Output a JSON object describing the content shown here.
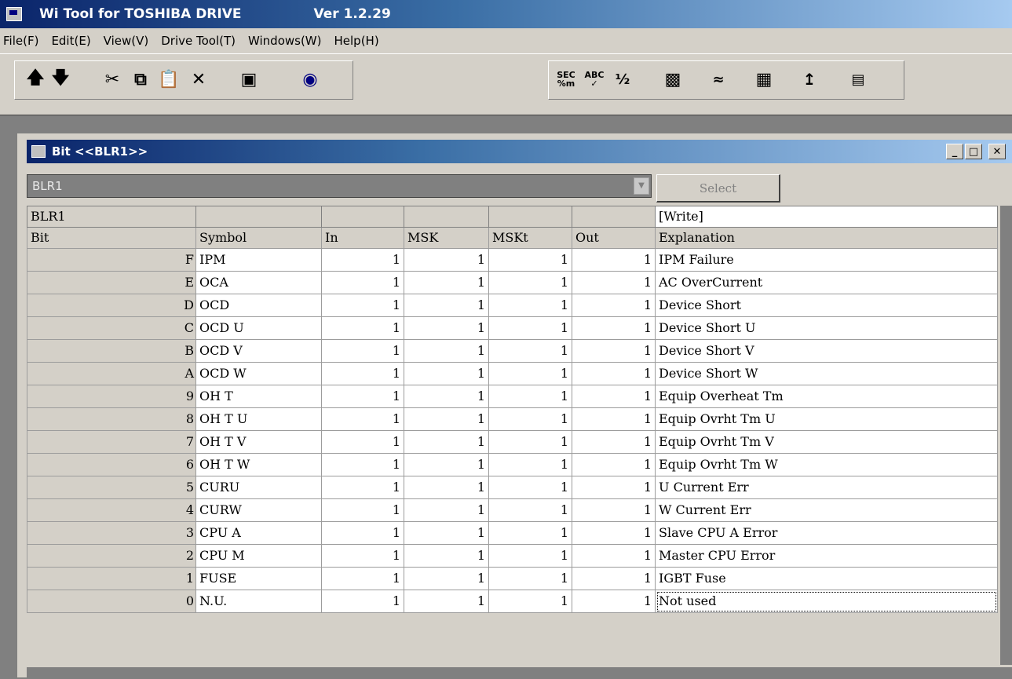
{
  "app": {
    "title": "Wi Tool  for TOSHIBA DRIVE",
    "version": "Ver 1.2.29"
  },
  "menu": [
    "File(F)",
    "Edit(E)",
    "View(V)",
    "Drive Tool(T)",
    "Windows(W)",
    "Help(H)"
  ],
  "toolbar": {
    "left_icons": [
      "arrow-up-icon",
      "arrow-down-icon",
      "cut-icon",
      "copy-icon",
      "paste-icon",
      "delete-icon",
      "properties-icon",
      "monitor-eye-icon"
    ],
    "right_icons": [
      "sec-icon",
      "abc-check-icon",
      "fraction-icon",
      "save-disk-icon",
      "waveform-icon",
      "folder-icon",
      "chart-icon",
      "percent-icon"
    ]
  },
  "child": {
    "title": "Bit <<BLR1>>",
    "selector_value": "BLR1",
    "select_label": "Select"
  },
  "grid": {
    "corner_label": "BLR1",
    "write_label": "[Write]",
    "columns": [
      "Bit",
      "Symbol",
      "In",
      "MSK",
      "MSKt",
      "Out",
      "Explanation"
    ],
    "rows": [
      {
        "bit": "F",
        "symbol": "IPM",
        "in": "1",
        "msk": "1",
        "mskt": "1",
        "out": "1",
        "explanation": "IPM Failure"
      },
      {
        "bit": "E",
        "symbol": "OCA",
        "in": "1",
        "msk": "1",
        "mskt": "1",
        "out": "1",
        "explanation": "AC OverCurrent"
      },
      {
        "bit": "D",
        "symbol": "OCD",
        "in": "1",
        "msk": "1",
        "mskt": "1",
        "out": "1",
        "explanation": "Device Short"
      },
      {
        "bit": "C",
        "symbol": "OCD  U",
        "in": "1",
        "msk": "1",
        "mskt": "1",
        "out": "1",
        "explanation": "Device Short U"
      },
      {
        "bit": "B",
        "symbol": "OCD  V",
        "in": "1",
        "msk": "1",
        "mskt": "1",
        "out": "1",
        "explanation": "Device Short V"
      },
      {
        "bit": "A",
        "symbol": "OCD  W",
        "in": "1",
        "msk": "1",
        "mskt": "1",
        "out": "1",
        "explanation": "Device Short W"
      },
      {
        "bit": "9",
        "symbol": "OH  T",
        "in": "1",
        "msk": "1",
        "mskt": "1",
        "out": "1",
        "explanation": "Equip Overheat Tm"
      },
      {
        "bit": "8",
        "symbol": "OH  T  U",
        "in": "1",
        "msk": "1",
        "mskt": "1",
        "out": "1",
        "explanation": "Equip Ovrht Tm U"
      },
      {
        "bit": "7",
        "symbol": "OH  T  V",
        "in": "1",
        "msk": "1",
        "mskt": "1",
        "out": "1",
        "explanation": "Equip Ovrht Tm V"
      },
      {
        "bit": "6",
        "symbol": "OH  T  W",
        "in": "1",
        "msk": "1",
        "mskt": "1",
        "out": "1",
        "explanation": "Equip Ovrht Tm W"
      },
      {
        "bit": "5",
        "symbol": "CURU",
        "in": "1",
        "msk": "1",
        "mskt": "1",
        "out": "1",
        "explanation": "U Current Err"
      },
      {
        "bit": "4",
        "symbol": "CURW",
        "in": "1",
        "msk": "1",
        "mskt": "1",
        "out": "1",
        "explanation": "W Current Err"
      },
      {
        "bit": "3",
        "symbol": "CPU  A",
        "in": "1",
        "msk": "1",
        "mskt": "1",
        "out": "1",
        "explanation": "Slave CPU A Error"
      },
      {
        "bit": "2",
        "symbol": "CPU  M",
        "in": "1",
        "msk": "1",
        "mskt": "1",
        "out": "1",
        "explanation": "Master CPU Error"
      },
      {
        "bit": "1",
        "symbol": "FUSE",
        "in": "1",
        "msk": "1",
        "mskt": "1",
        "out": "1",
        "explanation": "IGBT Fuse"
      },
      {
        "bit": "0",
        "symbol": "N.U.",
        "in": "1",
        "msk": "1",
        "mskt": "1",
        "out": "1",
        "explanation": "Not used"
      }
    ]
  }
}
